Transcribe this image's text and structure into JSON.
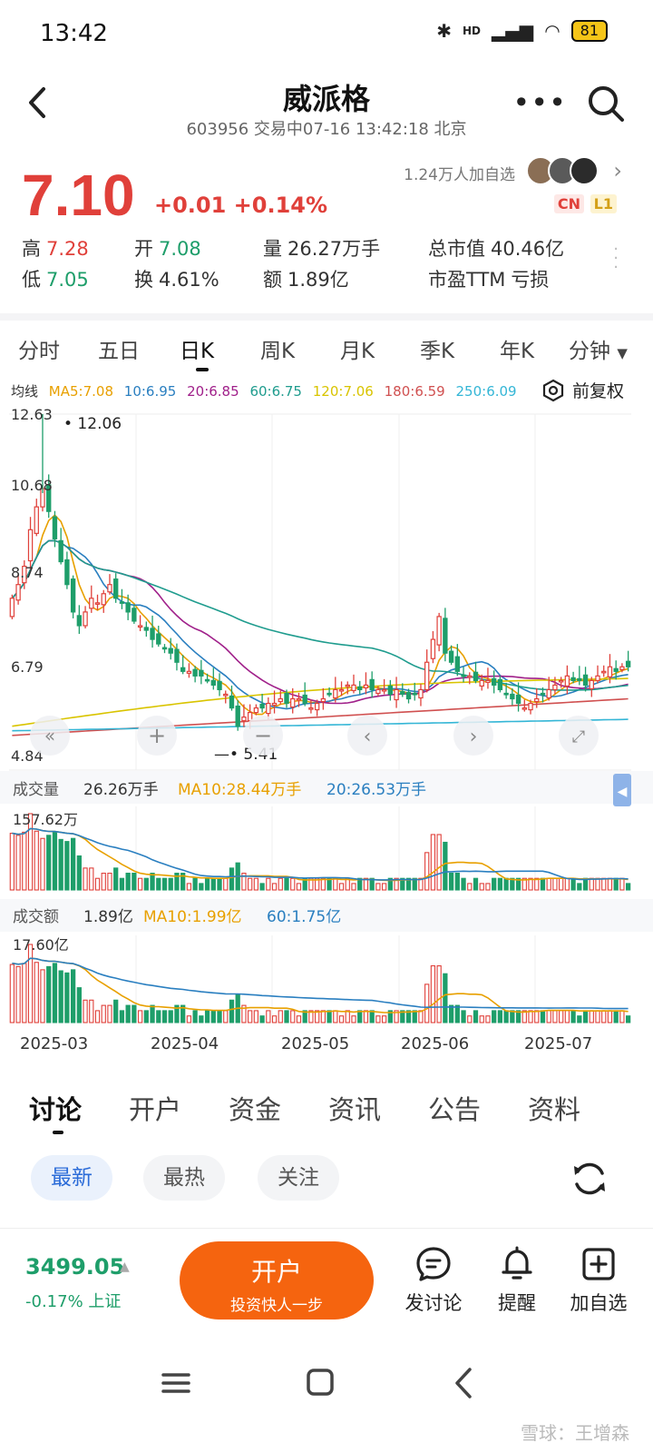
{
  "status": {
    "time": "13:42",
    "network": "HD",
    "battery": "81"
  },
  "header": {
    "title": "威派格",
    "subtitle": "603956 交易中07-16 13:42:18 北京"
  },
  "quote": {
    "price": "7.10",
    "change": "+0.01 +0.14%",
    "followers": "1.24万人加自选",
    "badge_cn": "CN",
    "badge_l1": "L1",
    "high_label": "高",
    "high": "7.28",
    "low_label": "低",
    "low": "7.05",
    "open_label": "开",
    "open": "7.08",
    "turnover_label": "换",
    "turnover": "4.61%",
    "volume_label": "量",
    "volume": "26.27万手",
    "amount_label": "额",
    "amount": "1.89亿",
    "mktcap_label": "总市值",
    "mktcap": "40.46亿",
    "pe_label": "市盈TTM",
    "pe": "亏损"
  },
  "period_tabs": [
    "分时",
    "五日",
    "日K",
    "周K",
    "月K",
    "季K",
    "年K",
    "分钟"
  ],
  "ma": {
    "label": "均线",
    "items": [
      {
        "text": "MA5:7.08",
        "color": "#e8a000"
      },
      {
        "text": "10:6.95",
        "color": "#2a7fc0"
      },
      {
        "text": "20:6.85",
        "color": "#a0208a"
      },
      {
        "text": "60:6.75",
        "color": "#1f9c8e"
      },
      {
        "text": "120:7.06",
        "color": "#d9c400"
      },
      {
        "text": "180:6.59",
        "color": "#d05050"
      },
      {
        "text": "250:6.09",
        "color": "#34b6d6"
      }
    ],
    "fuquan": "前复权"
  },
  "chart_data": {
    "type": "candlestick",
    "y_labels": [
      "12.63",
      "10.68",
      "8.74",
      "6.79",
      "4.84"
    ],
    "max_annotation": "12.06",
    "min_annotation": "5.41",
    "x_labels": [
      "2025-03",
      "2025-04",
      "2025-05",
      "2025-06",
      "2025-07"
    ],
    "volume_panel": {
      "label": "成交量",
      "value": "26.26万手",
      "ma10": "MA10:28.44万手",
      "ma20": "20:26.53万手",
      "ymax": "157.62万"
    },
    "amount_panel": {
      "label": "成交额",
      "value": "1.89亿",
      "ma10": "MA10:1.99亿",
      "ma60": "60:1.75亿",
      "ymax": "17.60亿"
    },
    "closes": [
      8.6,
      8.9,
      9.3,
      10.1,
      10.6,
      11.0,
      10.5,
      9.9,
      9.4,
      8.9,
      8.3,
      8.0,
      8.3,
      8.6,
      8.5,
      8.7,
      8.9,
      8.6,
      8.5,
      8.3,
      8.1,
      8.0,
      7.9,
      7.7,
      7.6,
      7.5,
      7.4,
      7.2,
      7.0,
      7.0,
      6.9,
      6.9,
      6.8,
      6.7,
      6.6,
      6.5,
      6.2,
      5.8,
      6.0,
      6.1,
      6.2,
      6.2,
      6.3,
      6.3,
      6.4,
      6.3,
      6.4,
      6.4,
      6.3,
      6.2,
      6.3,
      6.4,
      6.5,
      6.6,
      6.6,
      6.7,
      6.7,
      6.6,
      6.7,
      6.6,
      6.6,
      6.6,
      6.5,
      6.6,
      6.5,
      6.4,
      6.5,
      6.6,
      7.2,
      7.7,
      8.2,
      7.4,
      7.2,
      7.0,
      6.9,
      6.9,
      6.8,
      6.8,
      6.8,
      6.7,
      6.6,
      6.5,
      6.4,
      6.3,
      6.2,
      6.3,
      6.4,
      6.5,
      6.6,
      6.7,
      6.8,
      6.9,
      6.8,
      6.8,
      6.7,
      6.8,
      6.9,
      7.0,
      7.1,
      7.0,
      7.1,
      7.1
    ]
  },
  "stock_tabs": [
    "讨论",
    "开户",
    "资金",
    "资讯",
    "公告",
    "资料"
  ],
  "filters": [
    "最新",
    "最热",
    "关注"
  ],
  "bottom": {
    "index_value": "3499.05",
    "index_change": "-0.17% 上证",
    "open_title": "开户",
    "open_sub": "投资快人一步",
    "actions": [
      "发讨论",
      "提醒",
      "加自选"
    ]
  },
  "watermark": "雪球：王增森"
}
